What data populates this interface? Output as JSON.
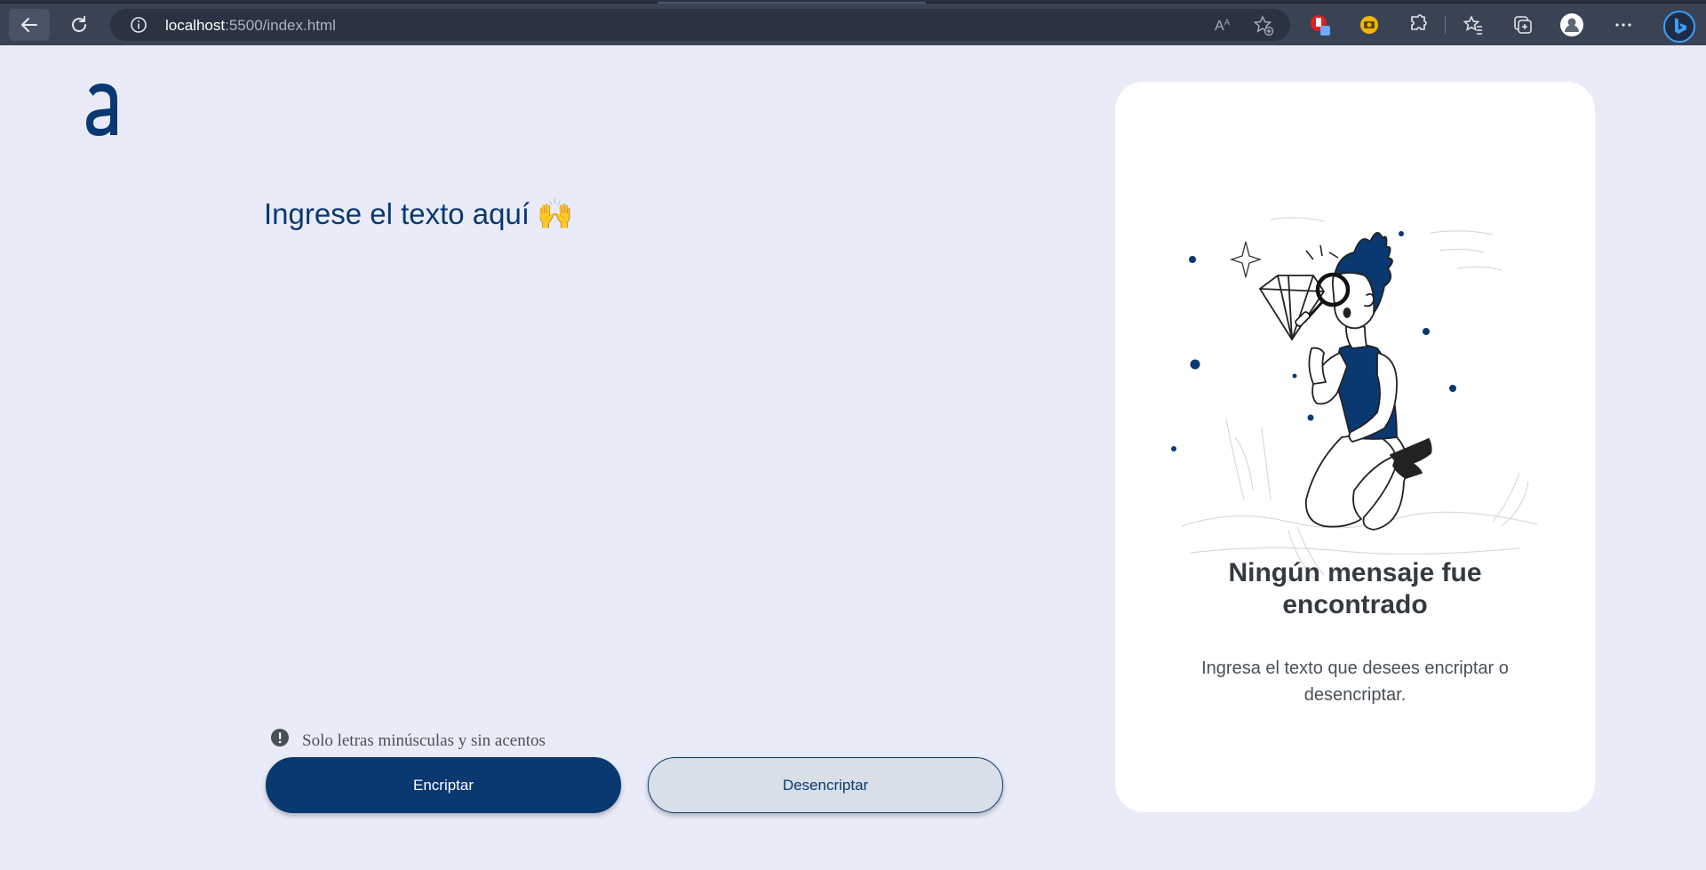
{
  "browser": {
    "url_host": "localhost",
    "url_rest": ":5500/index.html"
  },
  "page": {
    "heading": "Ingrese el texto aquí",
    "heading_emoji": "🙌",
    "hint": "Solo letras minúsculas y sin acentos",
    "encrypt_label": "Encriptar",
    "decrypt_label": "Desencriptar"
  },
  "card": {
    "title": "Ningún mensaje fue encontrado",
    "description": "Ingresa el texto que desees encriptar o desencriptar."
  },
  "colors": {
    "primary": "#0a3871",
    "background": "#e9ecf8",
    "card": "#ffffff",
    "text_dark": "#343a40"
  },
  "icons": {
    "back": "arrow-left-icon",
    "reload": "reload-icon",
    "site_info": "info-icon",
    "read_aloud": "read-aloud-icon",
    "favorite_add": "star-add-icon",
    "extensions": "puzzle-icon",
    "favorites": "favorites-icon",
    "collections": "collections-icon",
    "profile": "profile-icon",
    "more": "more-icon",
    "bing": "bing-icon",
    "hint": "exclamation-circle-icon"
  }
}
